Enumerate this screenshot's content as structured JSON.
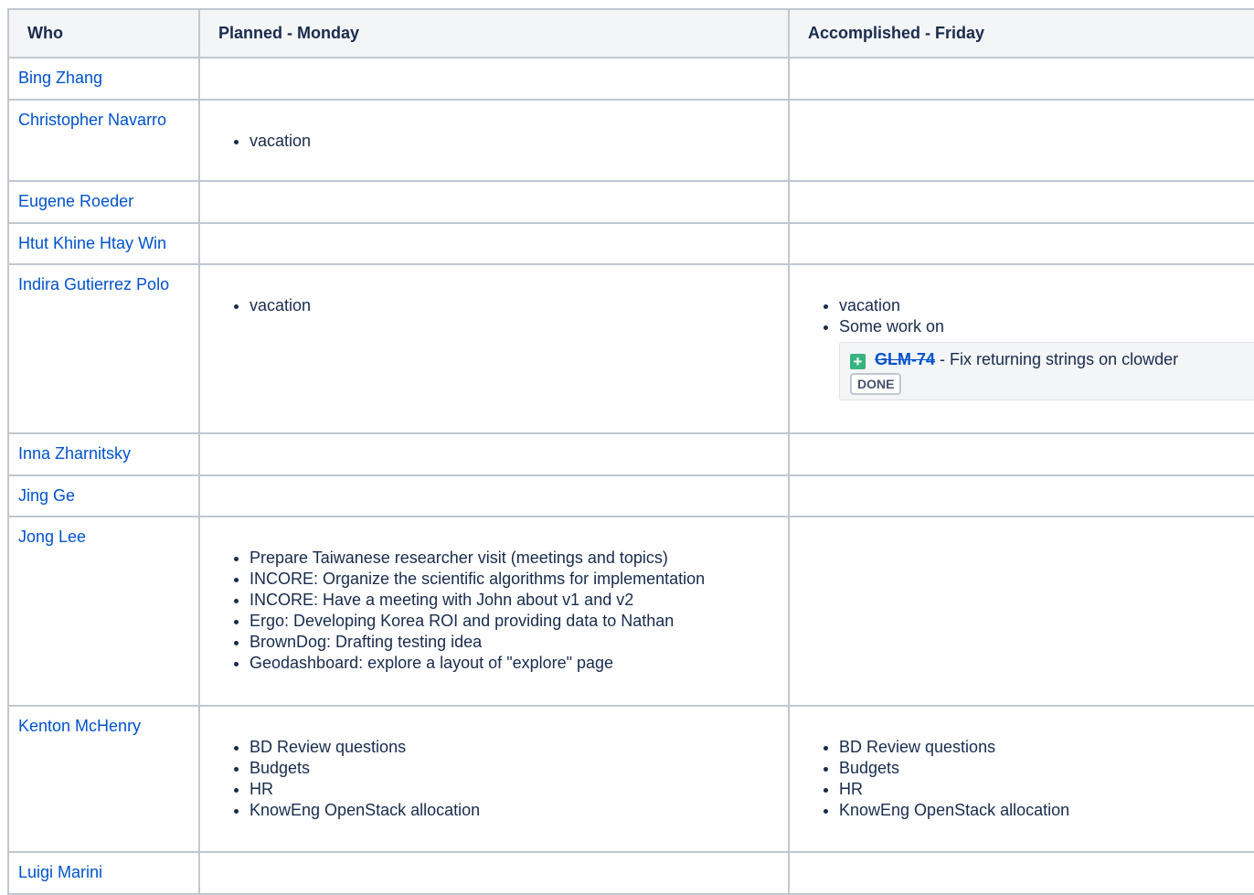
{
  "table": {
    "headers": [
      "Who",
      "Planned - Monday",
      "Accomplished - Friday"
    ],
    "rows": [
      {
        "who": "Bing Zhang",
        "planned": [],
        "accomplished": []
      },
      {
        "who": "Christopher Navarro",
        "planned": [
          "vacation"
        ],
        "accomplished": []
      },
      {
        "who": "Eugene Roeder",
        "planned": [],
        "accomplished": []
      },
      {
        "who": "Htut Khine Htay Win",
        "planned": [],
        "accomplished": []
      },
      {
        "who": "Indira Gutierrez Polo",
        "planned": [
          "vacation"
        ],
        "accomplished": [
          "vacation",
          "Some work on"
        ],
        "jira": {
          "key": "GLM-74",
          "summary": " - Fix returning strings on clowder",
          "status": "DONE"
        }
      },
      {
        "who": "Inna Zharnitsky",
        "planned": [],
        "accomplished": []
      },
      {
        "who": "Jing Ge",
        "planned": [],
        "accomplished": []
      },
      {
        "who": "Jong Lee",
        "planned": [
          "Prepare Taiwanese researcher visit (meetings and topics)",
          "INCORE: Organize the scientific algorithms for implementation",
          "INCORE: Have a meeting with John about v1 and v2",
          "Ergo: Developing Korea ROI and providing data to Nathan",
          "BrownDog: Drafting testing idea",
          "Geodashboard: explore a layout of \"explore\" page"
        ],
        "accomplished": []
      },
      {
        "who": "Kenton McHenry",
        "planned": [
          "BD Review questions",
          "Budgets",
          "HR",
          "KnowEng OpenStack allocation"
        ],
        "accomplished": [
          "BD Review questions",
          "Budgets",
          "HR",
          "KnowEng OpenStack allocation"
        ]
      },
      {
        "who": "Luigi Marini",
        "planned": [],
        "accomplished": []
      }
    ]
  }
}
